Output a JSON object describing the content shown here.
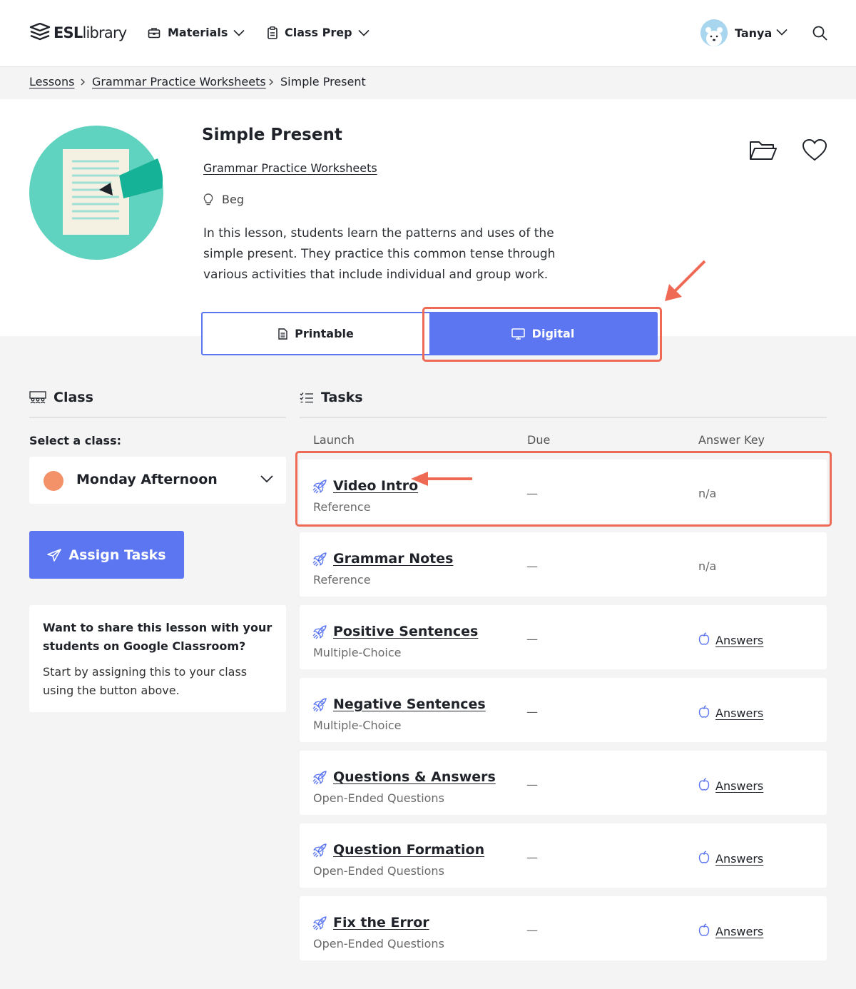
{
  "header": {
    "logo": {
      "brand": "ESL",
      "suffix": "library"
    },
    "nav": [
      {
        "label": "Materials",
        "icon": "briefcase-icon"
      },
      {
        "label": "Class Prep",
        "icon": "clipboard-icon"
      }
    ],
    "user": {
      "name": "Tanya",
      "avatar": "polar-bear-avatar"
    }
  },
  "breadcrumb": [
    "Lessons",
    "Grammar Practice Worksheets",
    "Simple Present"
  ],
  "lesson": {
    "title": "Simple Present",
    "category": "Grammar Practice Worksheets",
    "level": "Beg",
    "description": "In this lesson, students learn the patterns and uses of the simple present. They practice this common tense through various activities that include individual and group work.",
    "modes": [
      {
        "label": "Printable",
        "active": false
      },
      {
        "label": "Digital",
        "active": true
      }
    ]
  },
  "class_panel": {
    "heading": "Class",
    "select_label": "Select a class:",
    "selected_class": "Monday Afternoon",
    "selected_color": "#f39169",
    "assign_label": "Assign Tasks",
    "share_title": "Want to share this lesson with your students on Google Classroom?",
    "share_body": "Start by assigning this to your class using the button above."
  },
  "tasks_panel": {
    "heading": "Tasks",
    "columns": {
      "launch": "Launch",
      "due": "Due",
      "answer_key": "Answer Key"
    },
    "tasks": [
      {
        "name": "Video Intro",
        "type": "Reference",
        "due": "—",
        "answer": "n/a",
        "answer_link": false
      },
      {
        "name": "Grammar Notes",
        "type": "Reference",
        "due": "—",
        "answer": "n/a",
        "answer_link": false
      },
      {
        "name": "Positive Sentences",
        "type": "Multiple-Choice",
        "due": "—",
        "answer": "Answers",
        "answer_link": true
      },
      {
        "name": "Negative Sentences",
        "type": "Multiple-Choice",
        "due": "—",
        "answer": "Answers",
        "answer_link": true
      },
      {
        "name": "Questions & Answers",
        "type": "Open-Ended Questions",
        "due": "—",
        "answer": "Answers",
        "answer_link": true
      },
      {
        "name": "Question Formation",
        "type": "Open-Ended Questions",
        "due": "—",
        "answer": "Answers",
        "answer_link": true
      },
      {
        "name": "Fix the Error",
        "type": "Open-Ended Questions",
        "due": "—",
        "answer": "Answers",
        "answer_link": true
      }
    ]
  },
  "colors": {
    "accent": "#5b76f0",
    "highlight": "#ef6a55",
    "teal": "#5fd3bf"
  }
}
